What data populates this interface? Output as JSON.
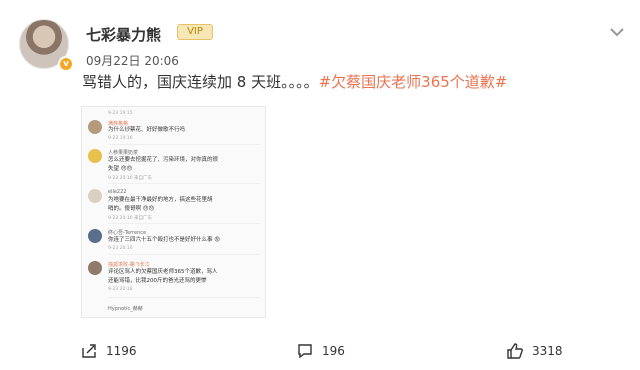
{
  "user": {
    "name": "七彩暴力熊",
    "badge": "VIP",
    "verified_mark": "v",
    "date": "09月22日 20:06"
  },
  "post": {
    "text": "骂错人的，国庆连续加 8 天班。。。。",
    "hashtag": "#欠蔡国庆老师365个道歉#"
  },
  "screenshot_comments": [
    {
      "time": "9-23 19:15",
      "name": "满族格格_",
      "text1": "为什么炒蔡花、好好做歌不行吗",
      "text2": "",
      "stamp": "9-23 19:16"
    },
    {
      "time": "",
      "name": "人参果果奶茶",
      "text1": "怎么还要去挖掘花了、污染环境，对你真的很",
      "text2": "失望 😠😠",
      "stamp": "9-23 20:10 来自广东"
    },
    {
      "time": "",
      "name": "elle222",
      "text1": "为啥要在最干净最好的地方，搞这些花里胡",
      "text2": "哨的。傻哥啊 😠😠",
      "stamp": "9-23 20:10 来自广东"
    },
    {
      "time": "",
      "name": "终心吾-Terrence",
      "text1": "你连了三四六十五个殴打也不是好好什么事 😡",
      "text2": "",
      "stamp": "9-23 20:16"
    },
    {
      "time": "",
      "name": "独孤求败-路飞长江",
      "text1": "评论区骂人的欠蔡国庆老师365个道歉，骂人",
      "text2": "还能骂错，比我200斤的爸光还骂的更惨",
      "stamp": "9-23 20:18"
    },
    {
      "time": "",
      "name": "Hypnotic_赫赫",
      "text1": "",
      "text2": "",
      "stamp": ""
    }
  ],
  "actions": {
    "share_count": "1196",
    "comment_count": "196",
    "like_count": "3318"
  },
  "colors": {
    "hashtag": "#eb7350",
    "verified": "#f5a623",
    "text": "#333333"
  }
}
